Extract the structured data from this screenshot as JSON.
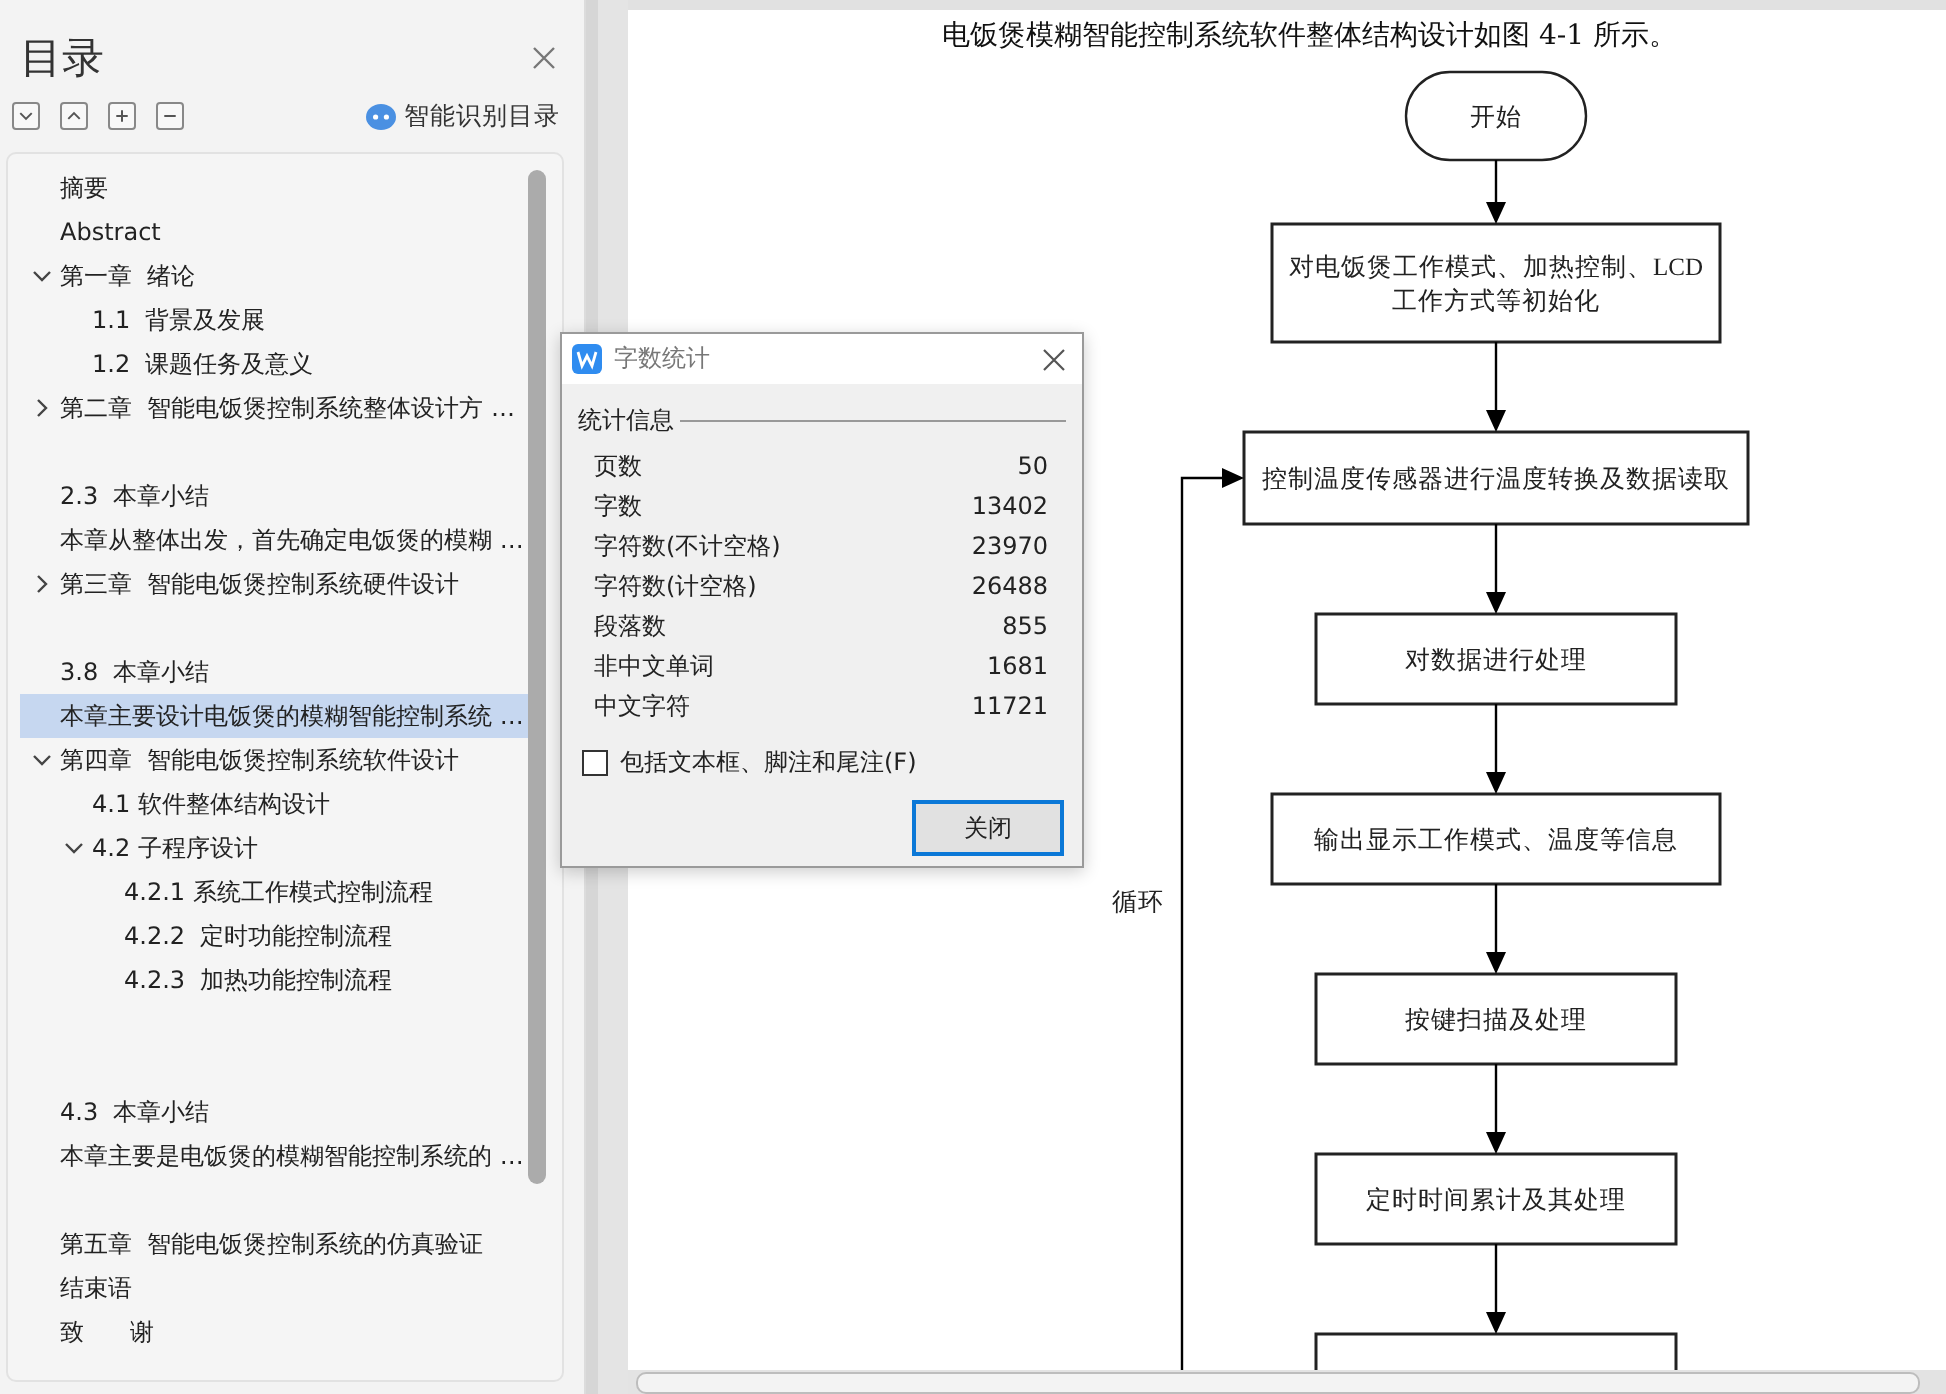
{
  "sidebar": {
    "title": "目录",
    "smart_toc": "智能识别目录",
    "toc": [
      {
        "kind": "entry",
        "text": "摘要",
        "selected": false
      },
      {
        "kind": "entry",
        "text": "Abstract",
        "selected": false
      },
      {
        "kind": "entry",
        "text": "第一章  绪论",
        "selected": false,
        "expanded": true,
        "children": [
          {
            "kind": "entry",
            "text": "1.1  背景及发展",
            "selected": false
          },
          {
            "kind": "entry",
            "text": "1.2  课题任务及意义",
            "selected": false
          }
        ]
      },
      {
        "kind": "entry",
        "text": "第二章  智能电饭煲控制系统整体设计方 …",
        "selected": false,
        "expanded": false
      },
      {
        "kind": "blank"
      },
      {
        "kind": "entry",
        "text": "2.3  本章小结",
        "selected": false
      },
      {
        "kind": "entry",
        "text": "本章从整体出发，首先确定电饭煲的模糊 …",
        "selected": false
      },
      {
        "kind": "entry",
        "text": "第三章  智能电饭煲控制系统硬件设计",
        "selected": false,
        "expanded": false
      },
      {
        "kind": "blank"
      },
      {
        "kind": "entry",
        "text": "3.8  本章小结",
        "selected": false
      },
      {
        "kind": "entry",
        "text": "本章主要设计电饭煲的模糊智能控制系统 …",
        "selected": true
      },
      {
        "kind": "entry",
        "text": "第四章  智能电饭煲控制系统软件设计",
        "selected": false,
        "expanded": true,
        "children": [
          {
            "kind": "entry",
            "text": "4.1 软件整体结构设计",
            "selected": false
          },
          {
            "kind": "entry",
            "text": "4.2 子程序设计",
            "selected": false,
            "expanded": true,
            "children": [
              {
                "kind": "entry",
                "text": "4.2.1 系统工作模式控制流程",
                "selected": false
              },
              {
                "kind": "entry",
                "text": "4.2.2  定时功能控制流程",
                "selected": false
              },
              {
                "kind": "entry",
                "text": "4.2.3  加热功能控制流程",
                "selected": false
              }
            ]
          }
        ]
      },
      {
        "kind": "blank"
      },
      {
        "kind": "blank"
      },
      {
        "kind": "entry",
        "text": "4.3  本章小结",
        "selected": false
      },
      {
        "kind": "entry",
        "text": "本章主要是电饭煲的模糊智能控制系统的 …",
        "selected": false
      },
      {
        "kind": "blank"
      },
      {
        "kind": "entry",
        "text": "第五章  智能电饭煲控制系统的仿真验证",
        "selected": false
      },
      {
        "kind": "entry",
        "text": "结束语",
        "selected": false
      },
      {
        "kind": "entry",
        "text": "致      谢",
        "selected": false
      }
    ]
  },
  "document": {
    "heading": "电饭煲模糊智能控制系统软件整体结构设计如图 4-1 所示。",
    "flowchart": {
      "loop_label": "循环",
      "nodes": [
        {
          "kind": "terminal",
          "lines": [
            "开始"
          ]
        },
        {
          "kind": "process",
          "lines": [
            "对电饭煲工作模式、加热控制、LCD",
            "工作方式等初始化"
          ]
        },
        {
          "kind": "process",
          "lines": [
            "控制温度传感器进行温度转换及数据读取"
          ]
        },
        {
          "kind": "process",
          "lines": [
            "对数据进行处理"
          ]
        },
        {
          "kind": "process",
          "lines": [
            "输出显示工作模式、温度等信息"
          ]
        },
        {
          "kind": "process",
          "lines": [
            "按键扫描及处理"
          ]
        },
        {
          "kind": "process",
          "lines": [
            "定时时间累计及其处理"
          ]
        },
        {
          "kind": "process"
        }
      ]
    }
  },
  "dialog": {
    "title": "字数统计",
    "section": "统计信息",
    "rows": [
      {
        "label": "页数",
        "value": "50"
      },
      {
        "label": "字数",
        "value": "13402"
      },
      {
        "label": "字符数(不计空格)",
        "value": "23970"
      },
      {
        "label": "字符数(计空格)",
        "value": "26488"
      },
      {
        "label": "段落数",
        "value": "855"
      },
      {
        "label": "非中文单词",
        "value": "1681"
      },
      {
        "label": "中文字符",
        "value": "11721"
      }
    ],
    "checkbox": {
      "label": "包括文本框、脚注和尾注(F)",
      "checked": false
    },
    "button": "关闭"
  }
}
